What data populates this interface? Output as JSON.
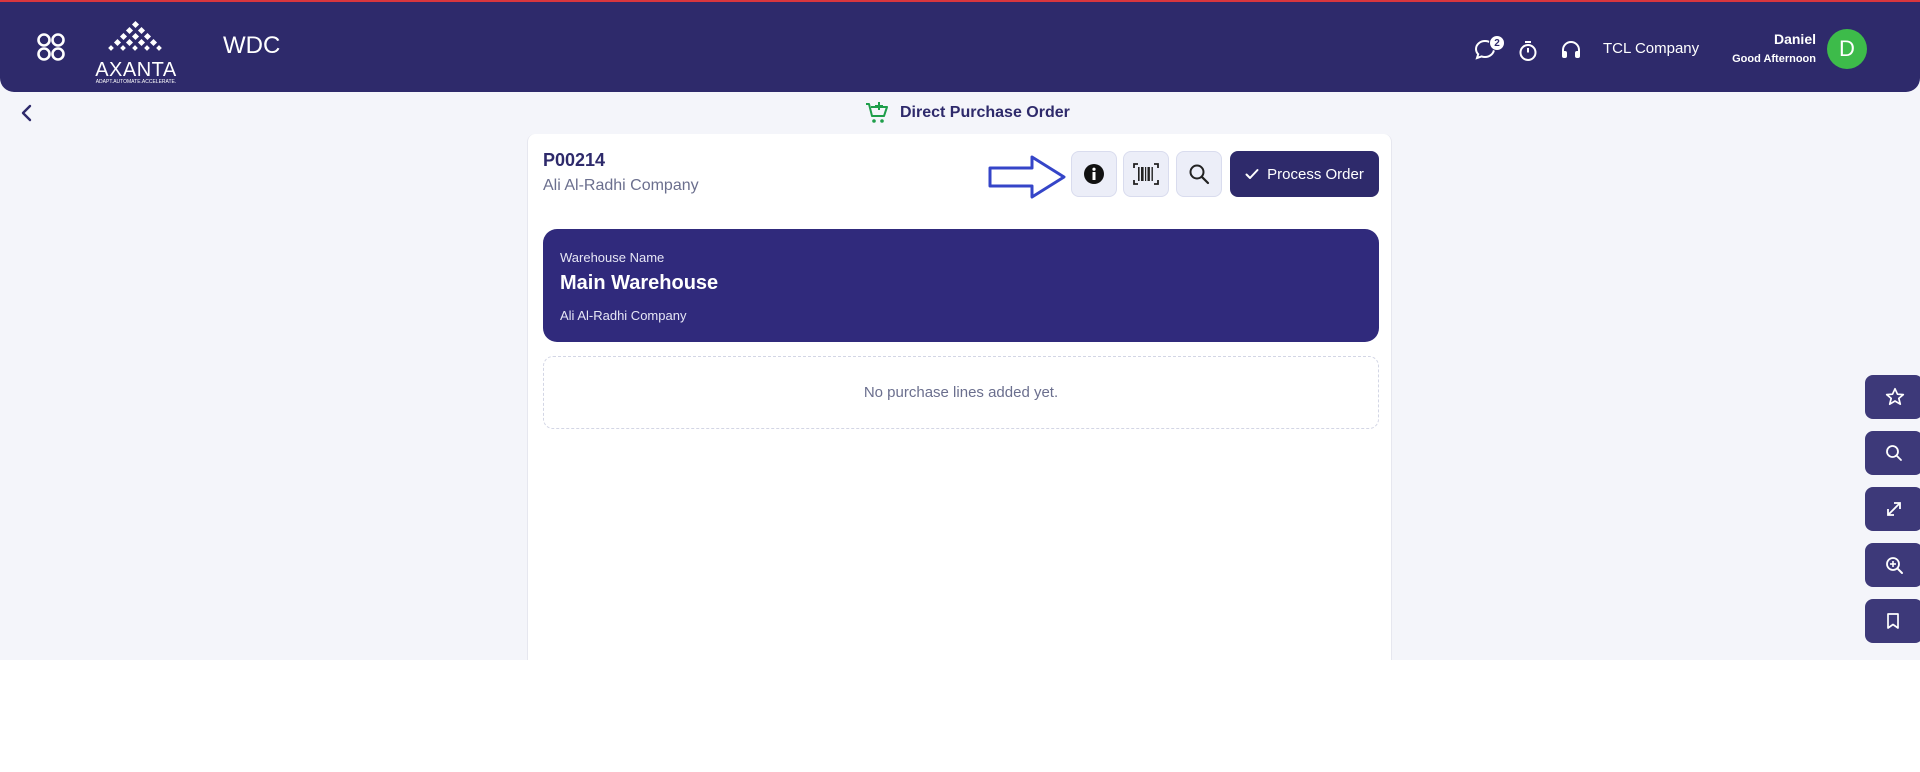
{
  "header": {
    "app_name": "WDC",
    "logo_text": "AXANTA",
    "logo_tagline": "ADAPT.AUTOMATE.ACCELERATE.",
    "notification_count": "2",
    "company": "TCL Company",
    "user_name": "Daniel",
    "greeting": "Good Afternoon",
    "avatar_initial": "D"
  },
  "page": {
    "title": "Direct Purchase Order"
  },
  "order": {
    "number": "P00214",
    "vendor": "Ali Al-Radhi Company",
    "process_label": "Process Order"
  },
  "warehouse": {
    "label": "Warehouse Name",
    "name": "Main Warehouse",
    "company": "Ali Al-Radhi Company"
  },
  "lines": {
    "empty_message": "No purchase lines added yet."
  },
  "colors": {
    "brand": "#2e2a6b",
    "panel": "#302a7c",
    "avatar": "#3dbb4a",
    "accent_line": "#d9363e",
    "cart_icon": "#1e9e4a"
  },
  "icons": {
    "apps": "grid-icon",
    "chat": "chat-icon",
    "timer": "stopwatch-icon",
    "support": "headset-icon",
    "info": "info-icon",
    "barcode": "barcode-icon",
    "search": "search-icon",
    "check": "check-icon",
    "favorite": "star-icon",
    "side_search": "search-icon",
    "expand": "expand-icon",
    "zoom": "zoom-in-icon",
    "bookmark": "bookmark-icon"
  }
}
